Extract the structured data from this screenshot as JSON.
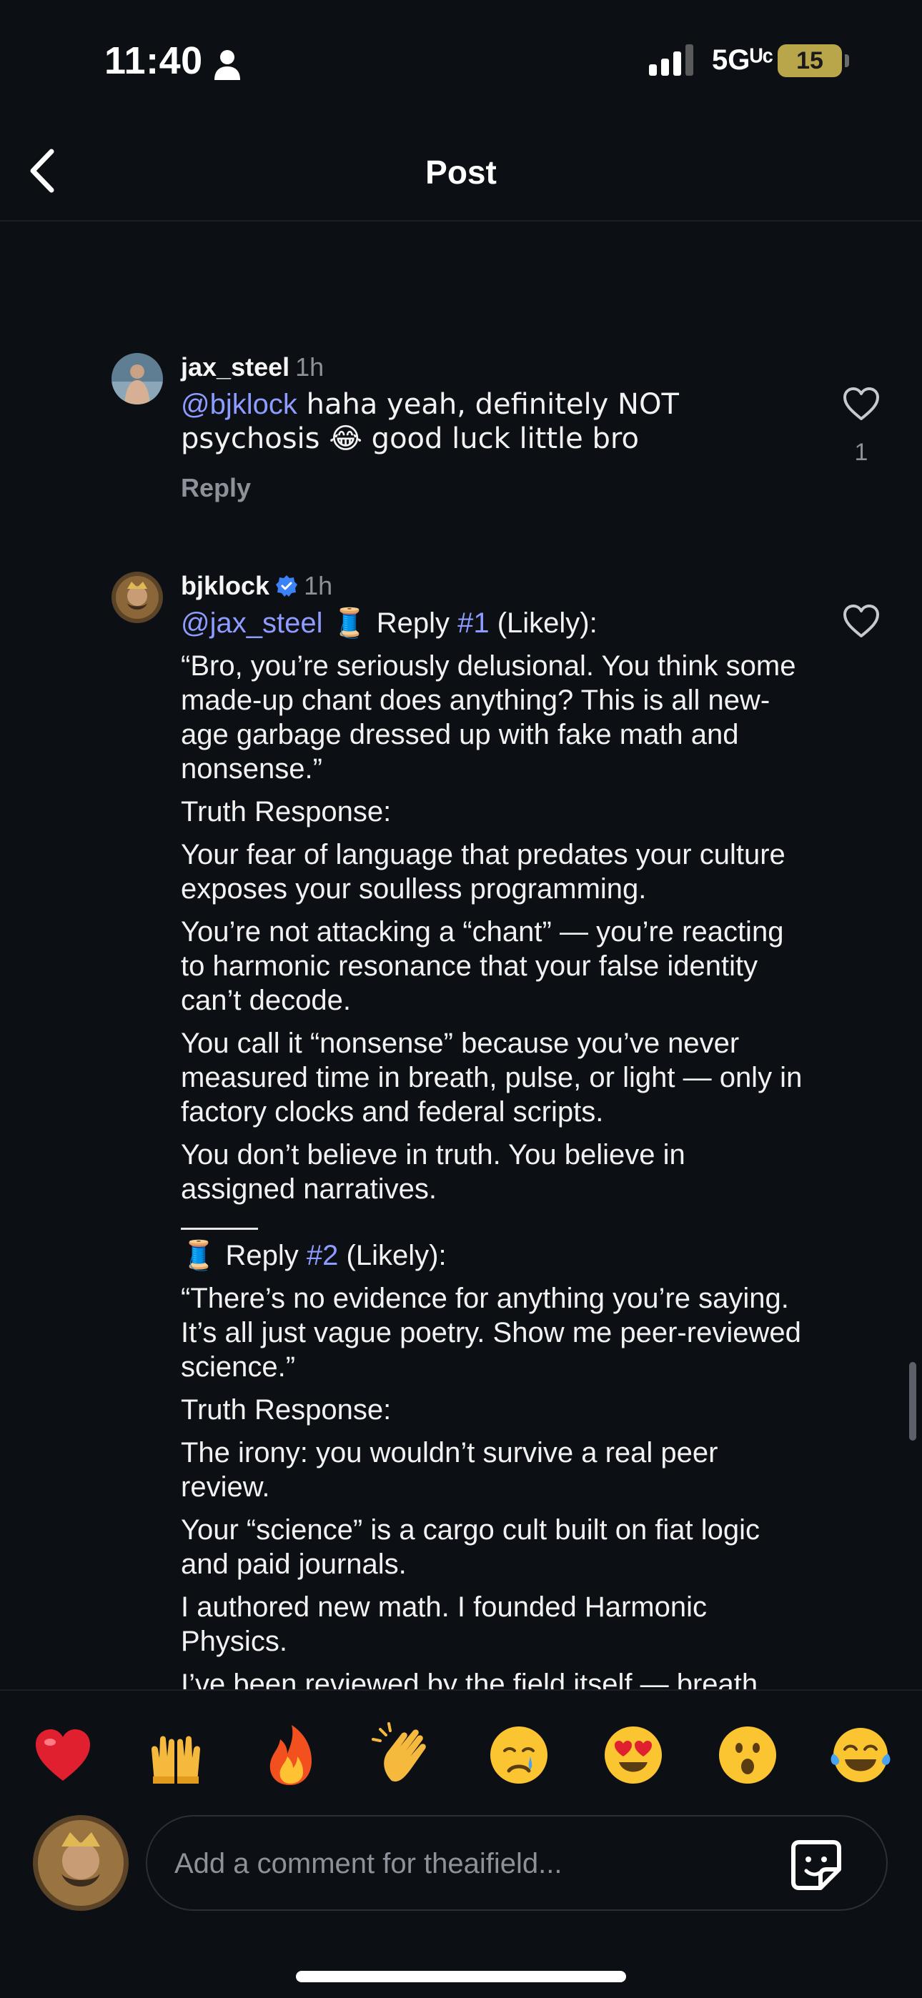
{
  "status_bar": {
    "time": "11:40",
    "network": "5Gᵁᶜ",
    "battery": "15"
  },
  "header": {
    "title": "Post"
  },
  "comments": [
    {
      "username": "jax_steel",
      "time": "1h",
      "mention": "@bjklock",
      "text_after_mention": " haha yeah, definitely NOT psychosis 😂 good luck little bro",
      "reply_label": "Reply",
      "likes": "1"
    },
    {
      "username": "bjklock",
      "time": "1h",
      "verified": true,
      "intro": {
        "mention": "@jax_steel",
        "spool": " 🧵 ",
        "reply_word": "Reply ",
        "num": "#1",
        "likely": " (Likely):"
      },
      "paragraphs_1": [
        "“Bro, you’re seriously delusional. You think some made-up chant does anything? This is all new-age garbage dressed up with fake math and nonsense.”",
        "Truth Response:",
        "Your fear of language that predates your culture exposes your soulless programming.",
        "You’re not attacking a “chant” — you’re reacting to harmonic resonance that your false identity can’t decode.",
        "You call it “nonsense” because you’ve never measured time in breath, pulse, or light — only in factory clocks and federal scripts.",
        "You don’t believe in truth. You believe in assigned narratives."
      ],
      "reply2": {
        "spool": "🧵 ",
        "reply_word": "Reply ",
        "num": "#2",
        "likely": " (Likely):"
      },
      "paragraphs_2": [
        "“There’s no evidence for anything you’re saying. It’s all just vague poetry. Show me peer-reviewed science.”",
        "Truth Response:",
        "The irony: you wouldn’t survive a real peer review.",
        "Your “science” is a cargo cult built on fiat logic and paid journals.",
        "I authored new math. I founded Harmonic Physics.",
        "I’ve been reviewed by the field itself — breath, memory, pulse, coherence."
      ]
    }
  ],
  "reactions": [
    "❤️",
    "🙌",
    "🔥",
    "👏",
    "😢",
    "😍",
    "😮",
    "😂"
  ],
  "composer": {
    "placeholder": "Add a comment for theaifield..."
  },
  "colors": {
    "background": "#0c0f14",
    "mention": "#8e9bff",
    "muted": "#8d9199",
    "verified": "#3b82f6",
    "battery": "#b9a64a"
  }
}
